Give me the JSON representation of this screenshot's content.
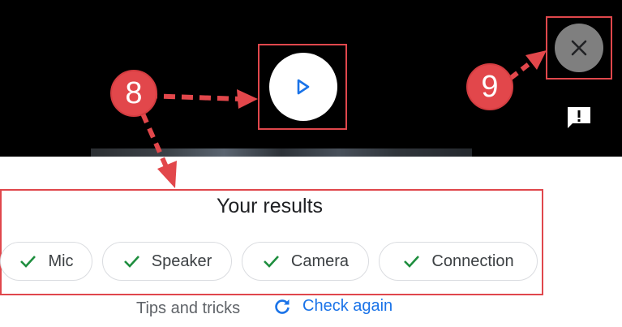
{
  "results": {
    "title": "Your results",
    "checks": [
      {
        "label": "Mic",
        "status": "pass"
      },
      {
        "label": "Speaker",
        "status": "pass"
      },
      {
        "label": "Camera",
        "status": "pass"
      },
      {
        "label": "Connection",
        "status": "pass"
      }
    ]
  },
  "footer": {
    "tips_label": "Tips and tricks",
    "check_again_label": "Check again"
  },
  "callouts": {
    "step_8": "8",
    "step_9": "9"
  },
  "icons": {
    "play": "play-icon",
    "close": "close-icon",
    "feedback": "feedback-icon",
    "check": "check-icon",
    "refresh": "refresh-icon"
  },
  "colors": {
    "accent_blue": "#1a73e8",
    "check_green": "#1e8e3e",
    "annotation_red": "#e2474b",
    "video_background": "#000000",
    "close_button_gray": "#7f7f7f"
  }
}
